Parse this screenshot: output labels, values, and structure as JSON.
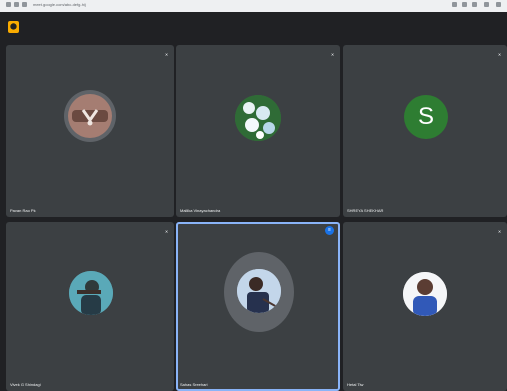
{
  "browser": {
    "url": "meet.google.com/abc-defg-hij"
  },
  "meeting": {
    "badge_icon": "meeting-badge-icon"
  },
  "participants": [
    {
      "name": "Pavan Rao Pk",
      "status": "muted"
    },
    {
      "name": "Mallika Vinayachandra",
      "status": "muted"
    },
    {
      "name": "SHREYA SHEKHAR",
      "status": "muted",
      "initial": "S",
      "avatar_color": "#2e7d32"
    },
    {
      "name": "Vivek G Shindagi",
      "status": "muted"
    },
    {
      "name": "Sahas Sreehari",
      "status": "speaking"
    },
    {
      "name": "Hetal Tiw",
      "status": "muted"
    }
  ]
}
